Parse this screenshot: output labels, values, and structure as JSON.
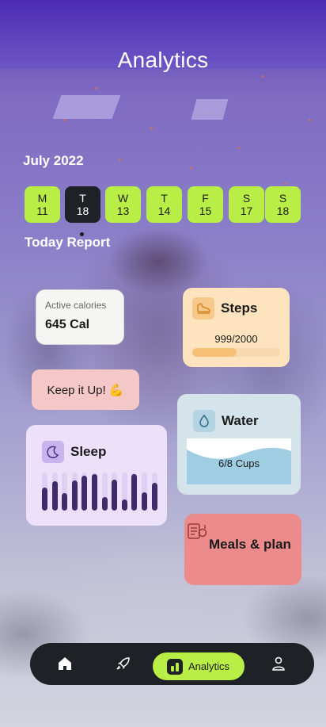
{
  "header": {
    "title": "Analytics"
  },
  "calendar": {
    "month": "July 2022",
    "days": [
      {
        "letter": "M",
        "date": "11"
      },
      {
        "letter": "T",
        "date": "18",
        "active": true
      },
      {
        "letter": "W",
        "date": "13"
      },
      {
        "letter": "T",
        "date": "14"
      },
      {
        "letter": "F",
        "date": "15"
      },
      {
        "letter": "S",
        "date": "17"
      },
      {
        "letter": "S",
        "date": "18"
      }
    ]
  },
  "report": {
    "heading": "Today Report"
  },
  "calories": {
    "label": "Active calories",
    "value": "645 Cal"
  },
  "steps": {
    "title": "Steps",
    "count": "999/2000",
    "progress": 0.5
  },
  "motivation": {
    "text": "Keep it Up! 💪"
  },
  "sleep": {
    "title": "Sleep",
    "levels": [
      0.6,
      0.78,
      0.45,
      0.8,
      0.92,
      0.96,
      0.35,
      0.82,
      0.3,
      0.96,
      0.48,
      0.72
    ]
  },
  "water": {
    "title": "Water",
    "text": "6/8 Cups"
  },
  "meals": {
    "title": "Meals & plan"
  },
  "nav": {
    "active_label": "Analytics"
  },
  "colors": {
    "accent": "#b9ee46",
    "dark": "#1e2226"
  }
}
